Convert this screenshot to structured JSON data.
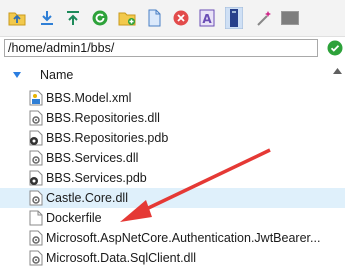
{
  "toolbar": {
    "buttons": [
      {
        "name": "navigate-up-folder-icon",
        "color": "#2f6fb5"
      },
      {
        "name": "download-icon",
        "color": "#2f7fd6"
      },
      {
        "name": "upload-icon",
        "color": "#1d8a5a"
      },
      {
        "name": "refresh-icon",
        "color": "#2da23a"
      },
      {
        "name": "new-folder-icon",
        "color": "#e8b400"
      },
      {
        "name": "new-file-icon",
        "color": "#4a7fc4"
      },
      {
        "name": "delete-icon",
        "color": "#e24b4b"
      },
      {
        "name": "rename-icon",
        "color": "#6a4cb5"
      },
      {
        "name": "properties-icon",
        "color": "#27408b"
      },
      {
        "name": "wand-icon",
        "color": "#d02a8a"
      },
      {
        "name": "terminal-icon",
        "color": "#888888"
      }
    ]
  },
  "path": {
    "value": "/home/admin1/bbs/"
  },
  "file_list": {
    "header": {
      "name_label": "Name"
    },
    "items": [
      {
        "name": "BBS.Model.xml",
        "type": "xml",
        "selected": false
      },
      {
        "name": "BBS.Repositories.dll",
        "type": "dll",
        "selected": false
      },
      {
        "name": "BBS.Repositories.pdb",
        "type": "pdb",
        "selected": false
      },
      {
        "name": "BBS.Services.dll",
        "type": "dll",
        "selected": false
      },
      {
        "name": "BBS.Services.pdb",
        "type": "pdb",
        "selected": false
      },
      {
        "name": "Castle.Core.dll",
        "type": "dll",
        "selected": true
      },
      {
        "name": "Dockerfile",
        "type": "file",
        "selected": false
      },
      {
        "name": "Microsoft.AspNetCore.Authentication.JwtBearer...",
        "type": "dll",
        "selected": false
      },
      {
        "name": "Microsoft.Data.SqlClient.dll",
        "type": "dll",
        "selected": false
      }
    ]
  },
  "annotation": {
    "color": "#e53935"
  }
}
